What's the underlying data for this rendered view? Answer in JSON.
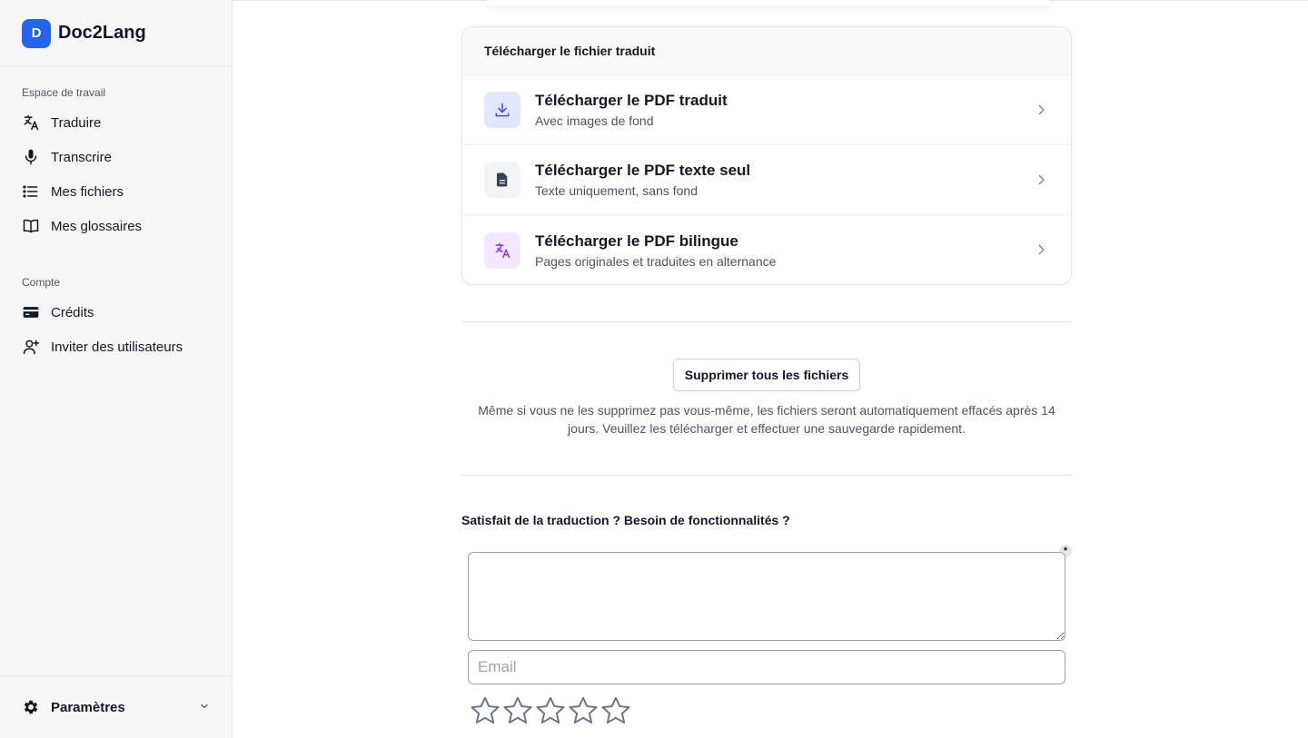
{
  "app": {
    "logo_letter": "D",
    "name": "Doc2Lang"
  },
  "sidebar": {
    "workspace_label": "Espace de travail",
    "workspace_items": [
      {
        "label": "Traduire",
        "icon": "translate-icon"
      },
      {
        "label": "Transcrire",
        "icon": "microphone-icon"
      },
      {
        "label": "Mes fichiers",
        "icon": "list-icon"
      },
      {
        "label": "Mes glossaires",
        "icon": "book-icon"
      }
    ],
    "account_label": "Compte",
    "account_items": [
      {
        "label": "Crédits",
        "icon": "credit-card-icon"
      },
      {
        "label": "Inviter des utilisateurs",
        "icon": "user-plus-icon"
      }
    ],
    "settings_label": "Paramètres"
  },
  "download_card": {
    "title": "Télécharger le fichier traduit",
    "items": [
      {
        "title": "Télécharger le PDF traduit",
        "subtitle": "Avec images de fond",
        "icon": "download-icon",
        "color": "#4f46e5"
      },
      {
        "title": "Télécharger le PDF texte seul",
        "subtitle": "Texte uniquement, sans fond",
        "icon": "document-icon",
        "color": "#374151"
      },
      {
        "title": "Télécharger le PDF bilingue",
        "subtitle": "Pages originales et traduites en alternance",
        "icon": "translate-icon",
        "color": "#9333ea"
      }
    ]
  },
  "delete_button": "Supprimer tous les fichiers",
  "delete_notice": "Même si vous ne les supprimez pas vous-même, les fichiers seront automatiquement effacés après 14 jours. Veuillez les télécharger et effectuer une sauvegarde rapidement.",
  "feedback": {
    "title": "Satisfait de la traduction ? Besoin de fonctionnalités ?",
    "required_marker": "*",
    "text_value": "",
    "email_placeholder": "Email",
    "email_value": "",
    "rating": 0,
    "rating_max": 5
  }
}
